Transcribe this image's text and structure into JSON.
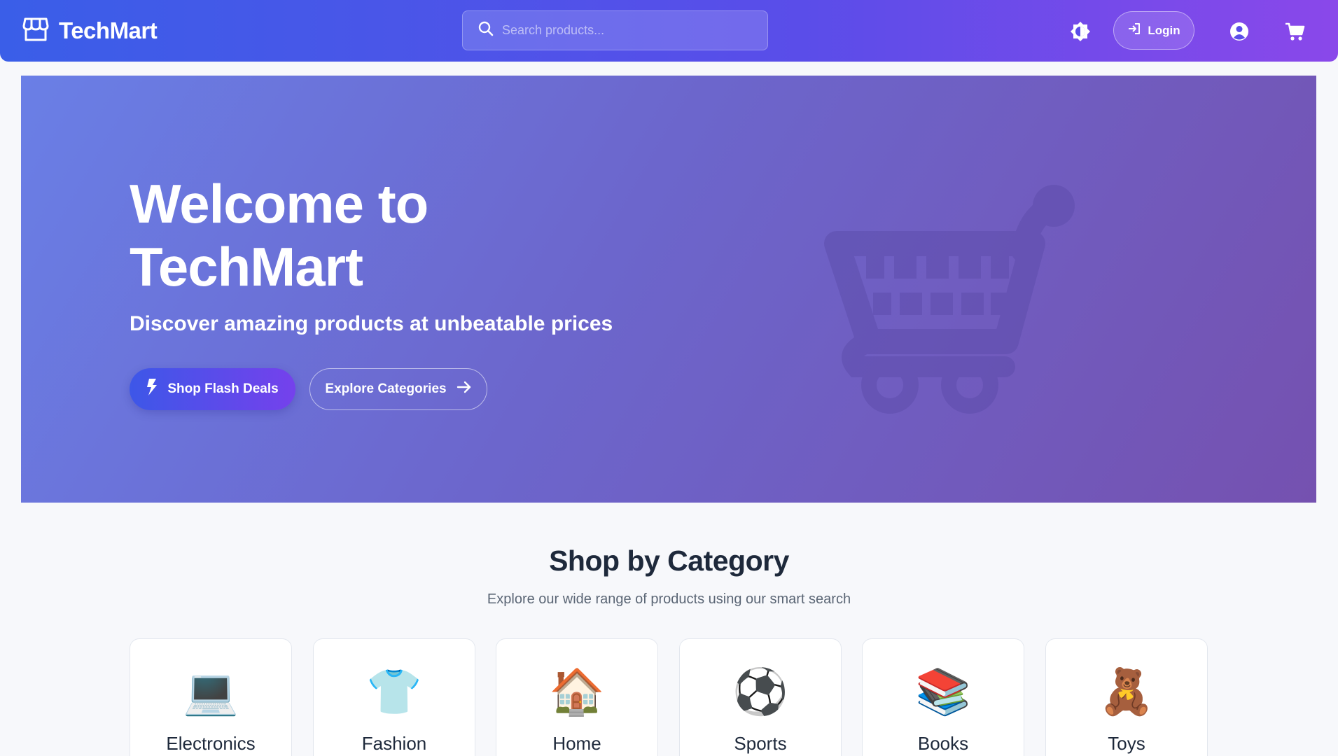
{
  "header": {
    "brand": "TechMart",
    "search_placeholder": "Search products...",
    "login_label": "Login",
    "icons": [
      "store-icon",
      "search-icon",
      "theme-toggle-icon",
      "login-icon",
      "user-icon",
      "cart-icon"
    ]
  },
  "hero": {
    "title_line1": "Welcome to",
    "title_line2": "TechMart",
    "subtitle": "Discover amazing products at unbeatable prices",
    "primary_button": "Shop Flash Deals",
    "secondary_button": "Explore Categories",
    "icons": [
      "bolt-icon",
      "arrow-right-icon",
      "shopping-cart-illustration"
    ]
  },
  "categories": {
    "title": "Shop by Category",
    "subtitle": "Explore our wide range of products using our smart search",
    "items": [
      {
        "label": "Electronics",
        "icon": "💻"
      },
      {
        "label": "Fashion",
        "icon": "👕"
      },
      {
        "label": "Home",
        "icon": "🏠"
      },
      {
        "label": "Sports",
        "icon": "⚽"
      },
      {
        "label": "Books",
        "icon": "📚"
      },
      {
        "label": "Toys",
        "icon": "🧸"
      }
    ]
  },
  "colors": {
    "header_start": "#3a5ee8",
    "header_end": "#8a48ea",
    "hero_start": "#6a7fe6",
    "hero_end": "#7551b0",
    "page_bg": "#f7f8fb"
  }
}
